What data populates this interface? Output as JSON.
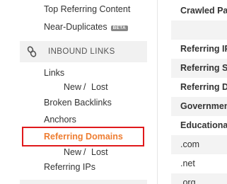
{
  "sidebar": {
    "items_top": {
      "top_referring_content": "Top Referring Content",
      "near_duplicates": "Near-Duplicates",
      "beta_badge": "BETA"
    },
    "inbound_section": {
      "title": "INBOUND LINKS",
      "icon": "chain-link-icon"
    },
    "links": {
      "label": "Links",
      "new": "New",
      "separator": "/",
      "lost": "Lost"
    },
    "broken_backlinks": "Broken Backlinks",
    "anchors": "Anchors",
    "referring_domains": {
      "label": "Referring Domains",
      "new": "New",
      "separator": "/",
      "lost": "Lost"
    },
    "referring_ips": "Referring IPs",
    "colors": {
      "active": "#ee7d31",
      "highlight_border": "#e0191c"
    }
  },
  "main": {
    "rows": [
      {
        "label": "Crawled Pa"
      },
      {
        "label": ""
      },
      {
        "label": "Referring IP"
      },
      {
        "label": "Referring Su"
      },
      {
        "label": "Referring Do"
      },
      {
        "label": "Governmen"
      },
      {
        "label": "Educational"
      },
      {
        "label": ".com"
      },
      {
        "label": ".net"
      },
      {
        "label": ".org"
      }
    ]
  }
}
